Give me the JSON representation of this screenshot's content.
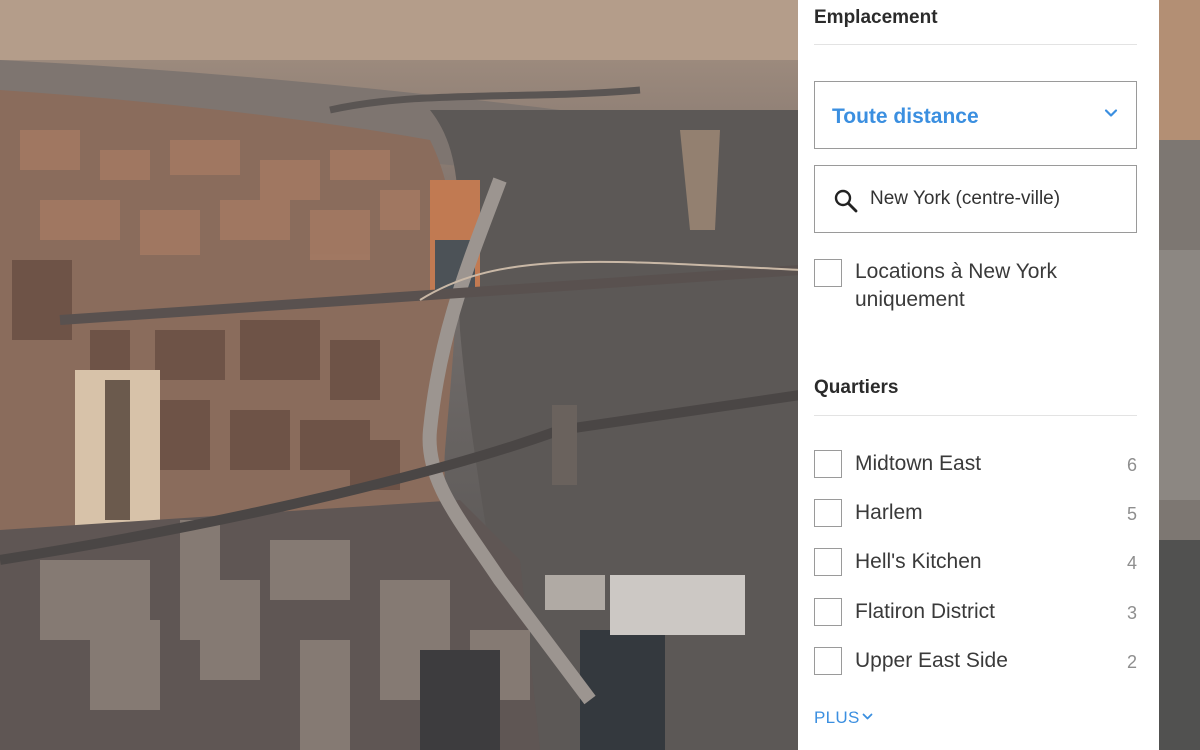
{
  "location": {
    "title": "Emplacement",
    "distance_select": {
      "selected": "Toute distance"
    },
    "search": {
      "value": "New York (centre-ville)"
    },
    "only_checkbox": {
      "label_line1": "Locations à New York",
      "label_line2": "uniquement",
      "checked": false
    }
  },
  "neighborhoods": {
    "title": "Quartiers",
    "items": [
      {
        "label": "Midtown East",
        "count": "6"
      },
      {
        "label": "Harlem",
        "count": "5"
      },
      {
        "label": "Hell's Kitchen",
        "count": "4"
      },
      {
        "label": "Flatiron District",
        "count": "3"
      },
      {
        "label": "Upper East Side",
        "count": "2"
      }
    ],
    "more_label": "PLUS"
  },
  "icons": {
    "select": "chevron-down-icon",
    "search": "magnifier-icon",
    "more": "chevron-down-icon"
  },
  "colors": {
    "accent": "#3b8fe0",
    "panel_bg": "#ffffff",
    "border": "#9a9a9a",
    "text": "#3a3a3a",
    "count": "#8e8e8e"
  }
}
